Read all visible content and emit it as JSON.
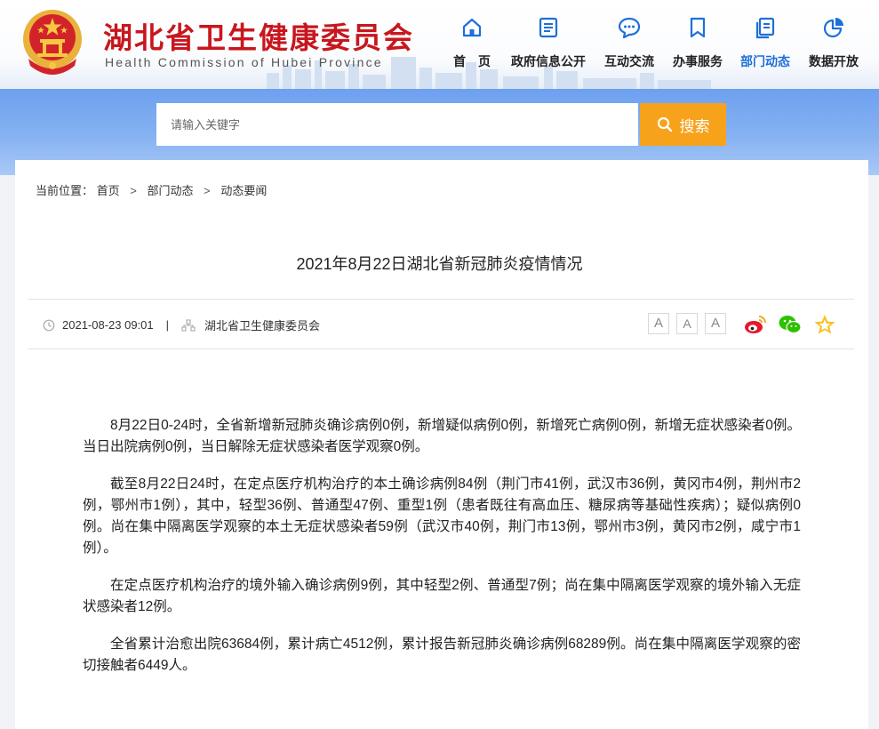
{
  "header": {
    "title": "湖北省卫生健康委员会",
    "subtitle": "Health Commission of Hubei Province"
  },
  "nav": {
    "items": [
      {
        "label": "首　页",
        "icon": "home-icon"
      },
      {
        "label": "政府信息公开",
        "icon": "document-list-icon"
      },
      {
        "label": "互动交流",
        "icon": "chat-bubble-icon"
      },
      {
        "label": "办事服务",
        "icon": "bookmark-icon"
      },
      {
        "label": "部门动态",
        "icon": "news-copy-icon",
        "active": true
      },
      {
        "label": "数据开放",
        "icon": "pie-chart-icon"
      }
    ],
    "active_color": "#1e6fd9"
  },
  "search": {
    "placeholder": "请输入关键字",
    "button_label": "搜索",
    "button_color": "#f7a21b"
  },
  "breadcrumb": {
    "prefix": "当前位置：",
    "items": [
      "首页",
      "部门动态",
      "动态要闻"
    ],
    "separator": ">"
  },
  "article": {
    "title": "2021年8月22日湖北省新冠肺炎疫情情况",
    "datetime": "2021-08-23 09:01",
    "divider": "|",
    "source": "湖北省卫生健康委员会",
    "font_sizes": [
      "A",
      "A",
      "A"
    ],
    "share": [
      "weibo-icon",
      "wechat-icon",
      "favorite-star-icon"
    ],
    "paragraphs": [
      "8月22日0-24时，全省新增新冠肺炎确诊病例0例，新增疑似病例0例，新增死亡病例0例，新增无症状感染者0例。当日出院病例0例，当日解除无症状感染者医学观察0例。",
      "截至8月22日24时，在定点医疗机构治疗的本土确诊病例84例（荆门市41例，武汉市36例，黄冈市4例，荆州市2例，鄂州市1例），其中，轻型36例、普通型47例、重型1例（患者既往有高血压、糖尿病等基础性疾病）；疑似病例0例。尚在集中隔离医学观察的本土无症状感染者59例（武汉市40例，荆门市13例，鄂州市3例，黄冈市2例，咸宁市1例）。",
      "在定点医疗机构治疗的境外输入确诊病例9例，其中轻型2例、普通型7例；尚在集中隔离医学观察的境外输入无症状感染者12例。",
      "全省累计治愈出院63684例，累计病亡4512例，累计报告新冠肺炎确诊病例68289例。尚在集中隔离医学观察的密切接触者6449人。"
    ]
  },
  "colors": {
    "brand_red": "#c8161d",
    "search_band": "#7aa9f0",
    "page_background": "#f1f3f6"
  }
}
